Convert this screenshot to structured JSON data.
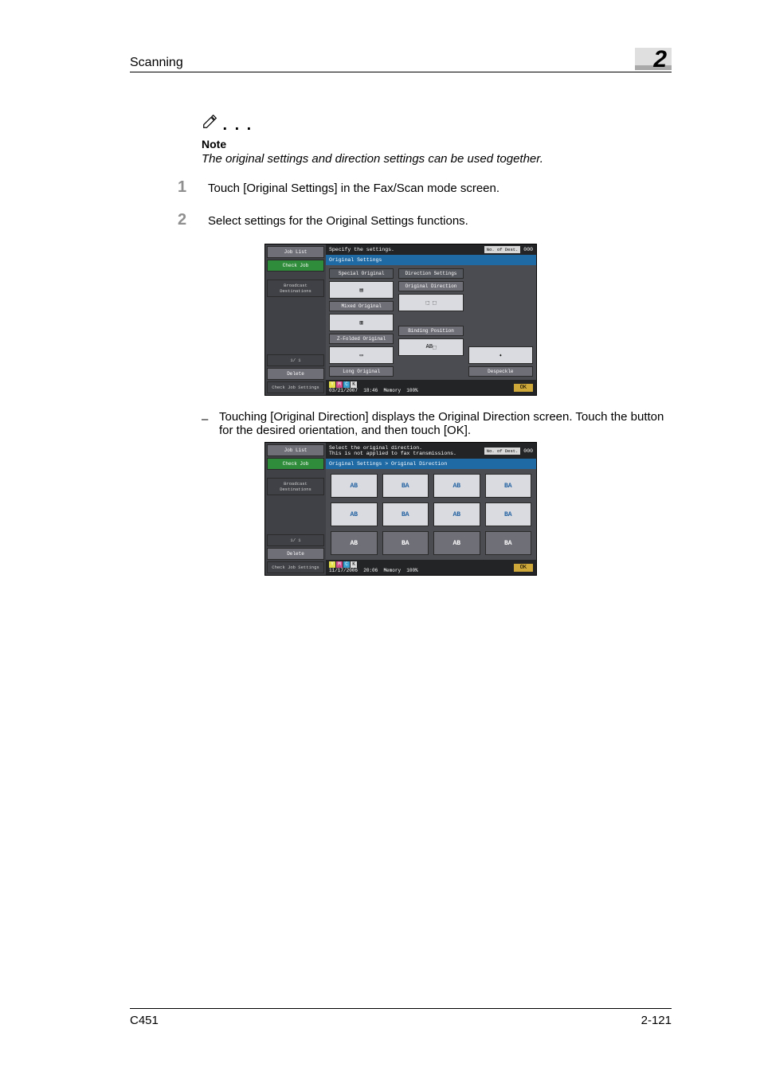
{
  "header": {
    "section": "Scanning",
    "chapter_number": "2"
  },
  "note": {
    "label": "Note",
    "text": "The original settings and direction settings can be used together."
  },
  "steps": [
    {
      "num": "1",
      "text": "Touch [Original Settings] in the Fax/Scan mode screen."
    },
    {
      "num": "2",
      "text": "Select settings for the Original Settings functions."
    }
  ],
  "substep": {
    "dash": "–",
    "text": "Touching [Original Direction] displays the Original Direction screen. Touch the button for the desired orientation, and then touch [OK]."
  },
  "screenshot1": {
    "side": {
      "job_list": "Job List",
      "check_job": "Check Job",
      "broadcast": "Broadcast Destinations",
      "page": "1/   1",
      "delete": "Delete",
      "check_set": "Check Job Settings"
    },
    "instruction": "Specify the settings.",
    "dest_badge": "No. of Dest.",
    "dest_count": "000",
    "crumb": "Original Settings",
    "col1": {
      "h": "Special Original",
      "b1": "Mixed Original",
      "b2": "Z-Folded Original",
      "b3": "Long Original"
    },
    "col2": {
      "h": "Direction Settings",
      "b1": "Original Direction",
      "b2": "Binding Position",
      "bp_glyph": "AB"
    },
    "col3": {
      "b1": "Despeckle"
    },
    "status": {
      "date": "03/21/2007",
      "time": "18:46",
      "mem_label": "Memory",
      "mem_val": "100%",
      "ok": "OK"
    }
  },
  "screenshot2": {
    "instruction_l1": "Select the original direction.",
    "instruction_l2": "This is not applied to fax transmissions.",
    "crumb": "Original Settings > Original Direction",
    "grid": [
      "AB",
      "BA",
      "AB",
      "BA",
      "AB",
      "BA",
      "AB",
      "BA",
      "AB",
      "BA",
      "AB",
      "BA"
    ],
    "status": {
      "date": "11/17/2006",
      "time": "20:06",
      "mem_label": "Memory",
      "mem_val": "100%",
      "ok": "OK"
    }
  },
  "footer": {
    "model": "C451",
    "page": "2-121"
  },
  "toner": {
    "y": "Y",
    "m": "M",
    "c": "C",
    "k": "K"
  }
}
